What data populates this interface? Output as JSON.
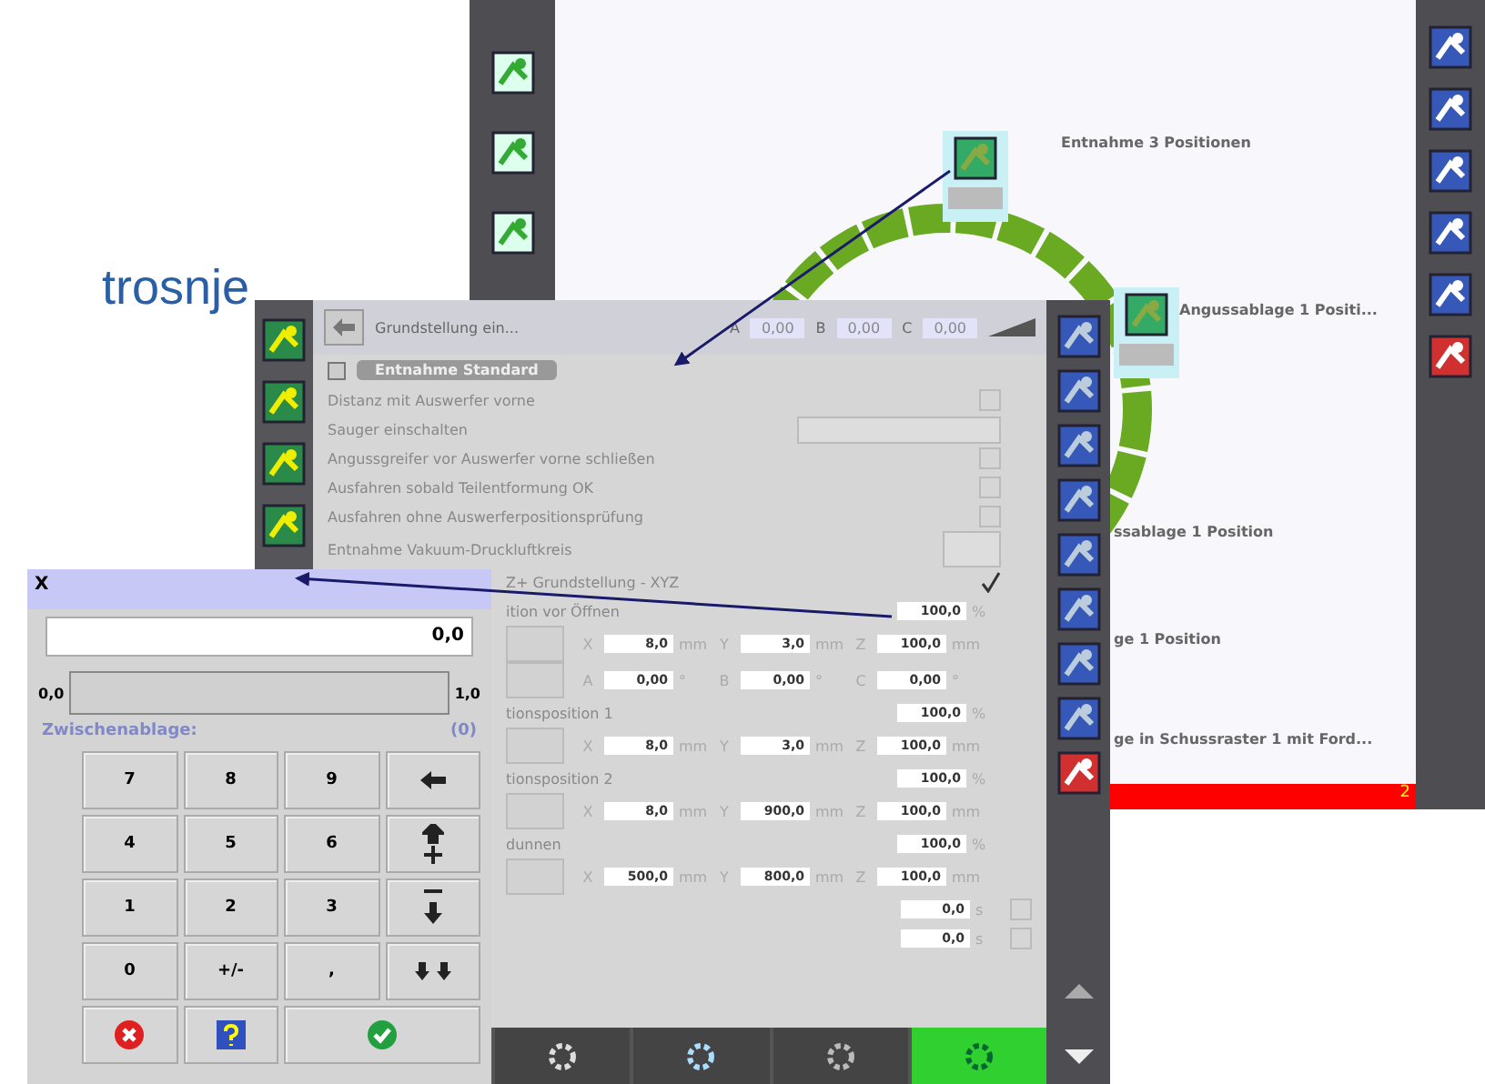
{
  "slide_title": "trosnje",
  "back_window": {
    "nodes": [
      {
        "label": "Entnahme 3 Positionen"
      },
      {
        "label": "Angussablage 1 Positi..."
      },
      {
        "label": "ssablage 1 Position"
      },
      {
        "label": "ge 1 Position"
      },
      {
        "label": "ge in Schussraster 1 mit Ford..."
      }
    ],
    "status_bar": {
      "count": "2"
    }
  },
  "middle_window": {
    "header": {
      "title": "Grundstellung ein...",
      "axes": [
        {
          "axis": "A",
          "value": "0,00"
        },
        {
          "axis": "B",
          "value": "0,00"
        },
        {
          "axis": "C",
          "value": "0,00"
        }
      ]
    },
    "tab": "Entnahme Standard",
    "rows": [
      {
        "kind": "check",
        "label": "Distanz mit Auswerfer vorne",
        "checked": false
      },
      {
        "kind": "select",
        "label": "Sauger einschalten"
      },
      {
        "kind": "check",
        "label": "Angussgreifer vor Auswerfer vorne schließen",
        "checked": false
      },
      {
        "kind": "check",
        "label": "Ausfahren sobald Teilentformung OK",
        "checked": false
      },
      {
        "kind": "check",
        "label": "Ausfahren ohne Auswerferpositionsprüfung",
        "checked": false
      },
      {
        "kind": "button",
        "label": "Entnahme Vakuum-Druckluftkreis"
      },
      {
        "kind": "check",
        "label": "Z+ Grundstellung - XYZ",
        "checked": true
      },
      {
        "kind": "value",
        "label": "ition vor Öffnen",
        "value": "100,0",
        "unit": "%"
      },
      {
        "kind": "triple",
        "fields": [
          {
            "axis": "X",
            "value": "8,0",
            "unit": "mm"
          },
          {
            "axis": "Y",
            "value": "3,0",
            "unit": "mm"
          },
          {
            "axis": "Z",
            "value": "100,0",
            "unit": "mm"
          }
        ]
      },
      {
        "kind": "triple",
        "fields": [
          {
            "axis": "A",
            "value": "0,00",
            "unit": "°"
          },
          {
            "axis": "B",
            "value": "0,00",
            "unit": "°"
          },
          {
            "axis": "C",
            "value": "0,00",
            "unit": "°"
          }
        ]
      },
      {
        "kind": "value",
        "label": "tionsposition 1",
        "value": "100,0",
        "unit": "%"
      },
      {
        "kind": "triple",
        "fields": [
          {
            "axis": "X",
            "value": "8,0",
            "unit": "mm"
          },
          {
            "axis": "Y",
            "value": "3,0",
            "unit": "mm"
          },
          {
            "axis": "Z",
            "value": "100,0",
            "unit": "mm"
          }
        ]
      },
      {
        "kind": "value",
        "label": "tionsposition 2",
        "value": "100,0",
        "unit": "%"
      },
      {
        "kind": "triple",
        "fields": [
          {
            "axis": "X",
            "value": "8,0",
            "unit": "mm"
          },
          {
            "axis": "Y",
            "value": "900,0",
            "unit": "mm"
          },
          {
            "axis": "Z",
            "value": "100,0",
            "unit": "mm"
          }
        ]
      },
      {
        "kind": "value",
        "label": "dunnen",
        "value": "100,0",
        "unit": "%"
      },
      {
        "kind": "triple",
        "fields": [
          {
            "axis": "X",
            "value": "500,0",
            "unit": "mm"
          },
          {
            "axis": "Y",
            "value": "800,0",
            "unit": "mm"
          },
          {
            "axis": "Z",
            "value": "100,0",
            "unit": "mm"
          }
        ]
      },
      {
        "kind": "timer",
        "value": "0,0",
        "unit": "s",
        "checked": false
      },
      {
        "kind": "timer",
        "value": "0,0",
        "unit": "s",
        "checked": false
      }
    ]
  },
  "keypad": {
    "title": "X",
    "display": "0,0",
    "range_min": "0,0",
    "range_max": "1,0",
    "clipboard_label": "Zwischenablage:",
    "clipboard_count": "(0)",
    "keys": [
      {
        "kind": "digit",
        "label": "7"
      },
      {
        "kind": "digit",
        "label": "8"
      },
      {
        "kind": "digit",
        "label": "9"
      },
      {
        "kind": "backspace"
      },
      {
        "kind": "digit",
        "label": "4"
      },
      {
        "kind": "digit",
        "label": "5"
      },
      {
        "kind": "digit",
        "label": "6"
      },
      {
        "kind": "increment"
      },
      {
        "kind": "digit",
        "label": "1"
      },
      {
        "kind": "digit",
        "label": "2"
      },
      {
        "kind": "digit",
        "label": "3"
      },
      {
        "kind": "decrement"
      },
      {
        "kind": "digit",
        "label": "0"
      },
      {
        "kind": "digit",
        "label": "+/-"
      },
      {
        "kind": "digit",
        "label": ","
      },
      {
        "kind": "double-down"
      },
      {
        "kind": "cancel"
      },
      {
        "kind": "help"
      },
      {
        "kind": "ok"
      }
    ]
  }
}
